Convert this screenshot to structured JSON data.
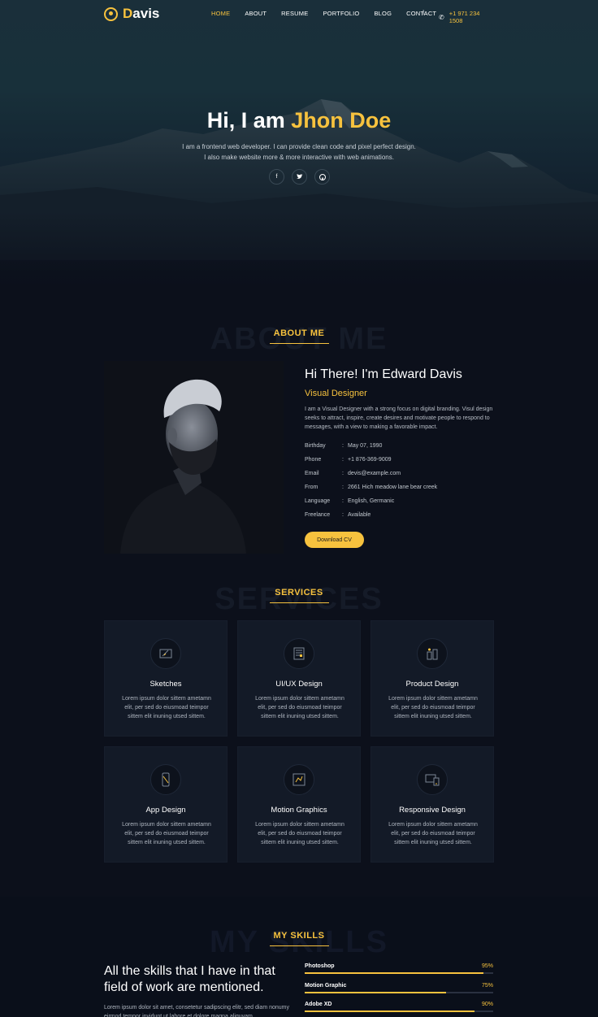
{
  "brand": {
    "first_letter": "D",
    "rest": "avis"
  },
  "nav": {
    "items": [
      {
        "label": "HOME",
        "active": true
      },
      {
        "label": "ABOUT"
      },
      {
        "label": "RESUME"
      },
      {
        "label": "PORTFOLIO"
      },
      {
        "label": "BLOG"
      },
      {
        "label": "CONTACT"
      }
    ],
    "separator": "I",
    "phone": "+1 971 234 1508"
  },
  "hero": {
    "greeting": "Hi, I am",
    "name": "Jhon Doe",
    "line1": "I am a frontend web developer. I can provide clean code and pixel perfect design.",
    "line2": "I also make website more & more interactive with web animations.",
    "socials": [
      "facebook-icon",
      "twitter-icon",
      "github-icon"
    ]
  },
  "about": {
    "bg_word": "ABOUT ME",
    "title": "ABOUT ME",
    "heading": "Hi There! I'm Edward Davis",
    "role": "Visual Designer",
    "paragraph": "I am a Visual Designer with a strong focus on digital branding. Visul design seeks to attract, inspire, create desires and motivate people to respond to messages, with a view to making a favorable impact.",
    "info": [
      {
        "key": "Birthday",
        "value": "May 07, 1990"
      },
      {
        "key": "Phone",
        "value": "+1 876-369-9009"
      },
      {
        "key": "Email",
        "value": "devis@example.com"
      },
      {
        "key": "From",
        "value": "2661 Hich meadow lane bear creek"
      },
      {
        "key": "Language",
        "value": "English, Germanic"
      },
      {
        "key": "Freelance",
        "value": "Available"
      }
    ],
    "button": "Download CV"
  },
  "services": {
    "bg_word": "SERVICES",
    "title": "SERVICES",
    "items": [
      {
        "title": "Sketches",
        "icon": "sketch-icon",
        "desc": "Lorem ipsum dolor sittem ametamn elit, per sed do eiusmoad teimpor sittem elit inuning utsed sittem."
      },
      {
        "title": "UI/UX Design",
        "icon": "ui-ux-icon",
        "desc": "Lorem ipsum dolor sittem ametamn elit, per sed do eiusmoad teimpor sittem elit inuning utsed sittem."
      },
      {
        "title": "Product Design",
        "icon": "product-icon",
        "desc": "Lorem ipsum dolor sittem ametamn elit, per sed do eiusmoad teimpor sittem elit inuning utsed sittem."
      },
      {
        "title": "App Design",
        "icon": "app-icon",
        "desc": "Lorem ipsum dolor sittem ametamn elit, per sed do eiusmoad teimpor sittem elit inuning utsed sittem."
      },
      {
        "title": "Motion Graphics",
        "icon": "motion-icon",
        "desc": "Lorem ipsum dolor sittem ametamn elit, per sed do eiusmoad teimpor sittem elit inuning utsed sittem."
      },
      {
        "title": "Responsive Design",
        "icon": "responsive-icon",
        "desc": "Lorem ipsum dolor sittem ametamn elit, per sed do eiusmoad teimpor sittem elit inuning utsed sittem."
      }
    ]
  },
  "skills": {
    "bg_word": "MY SKILLS",
    "title": "MY SKILLS",
    "heading": "All the skills that I have in that field of work are mentioned.",
    "paragraph": "Lorem ipsum dolor sit amet, consetetur sadipscing elitr, sed diam nonumy eirmod tempor invidunt ut labore et dolore magna aliquyam",
    "items": [
      {
        "name": "Photoshop",
        "percent": "95%",
        "level": 0.95
      },
      {
        "name": "Motion Graphic",
        "percent": "75%",
        "level": 0.75
      },
      {
        "name": "Adobe XD",
        "percent": "90%",
        "level": 0.9
      }
    ]
  },
  "colors": {
    "accent": "#f7c23e",
    "background": "#0c101b",
    "card": "#131a27"
  }
}
